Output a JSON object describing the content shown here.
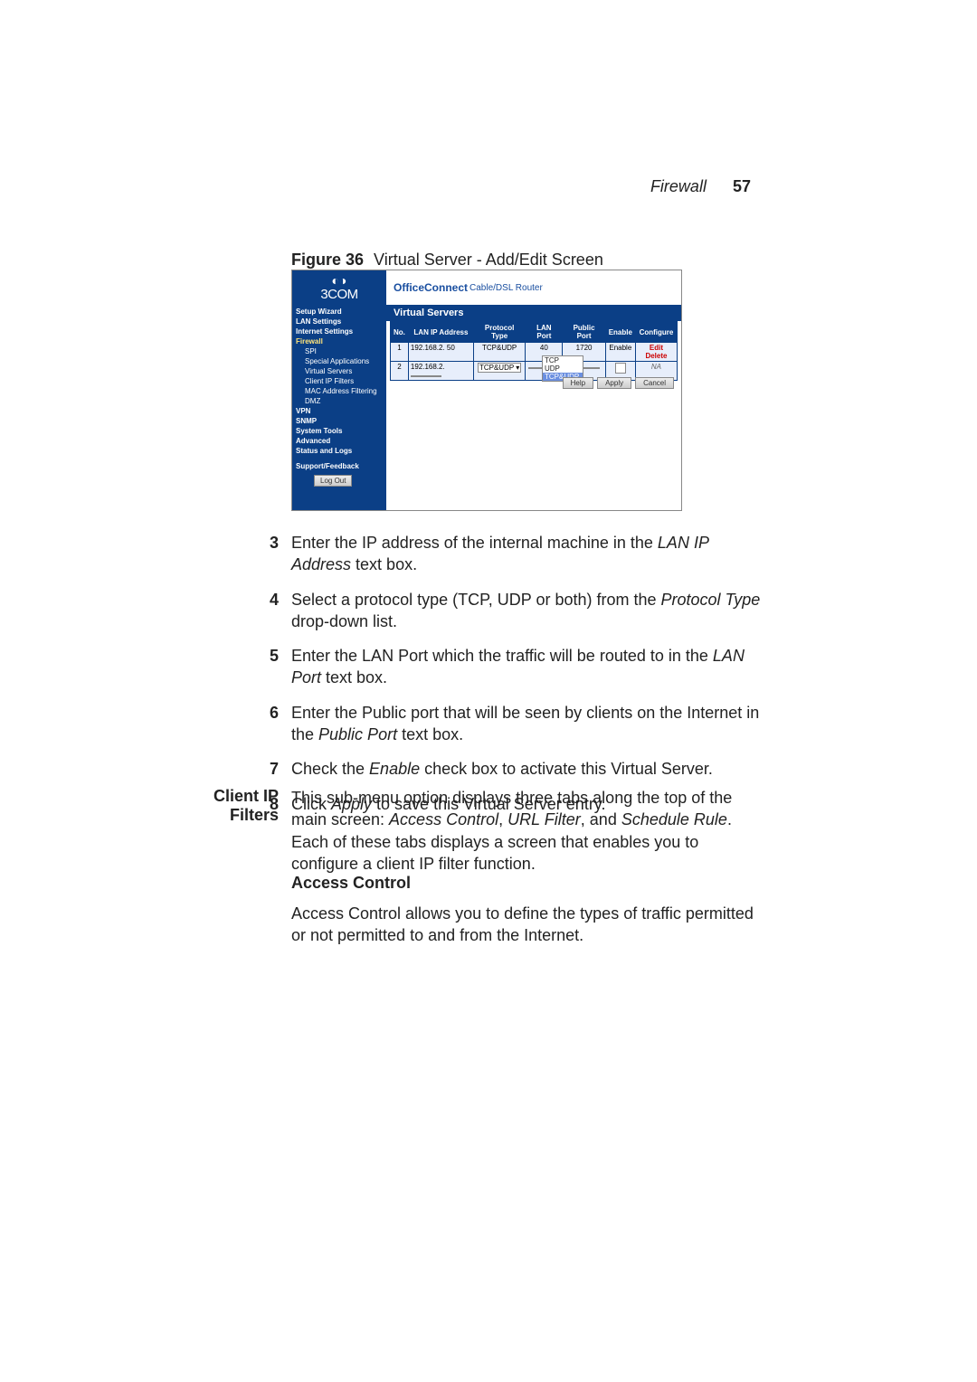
{
  "running_header": {
    "label": "Firewall",
    "page_num": "57"
  },
  "figure": {
    "label": "Figure 36",
    "caption": "Virtual Server - Add/Edit Screen"
  },
  "screenshot": {
    "brand_top": "3COM",
    "title_brand": "OfficeConnect",
    "title_sub": " Cable/DSL Router",
    "section": "Virtual Servers",
    "nav": {
      "items": [
        {
          "label": "Setup Wizard",
          "cls": "lvl0"
        },
        {
          "label": "LAN Settings",
          "cls": "lvl0"
        },
        {
          "label": "Internet Settings",
          "cls": "lvl0"
        },
        {
          "label": "Firewall",
          "cls": "lvl0 active"
        },
        {
          "label": "SPI",
          "cls": "lvl1"
        },
        {
          "label": "Special Applications",
          "cls": "lvl1"
        },
        {
          "label": "Virtual Servers",
          "cls": "lvl1"
        },
        {
          "label": "Client IP Filters",
          "cls": "lvl1"
        },
        {
          "label": "MAC Address Filtering",
          "cls": "lvl1"
        },
        {
          "label": "DMZ",
          "cls": "lvl1"
        },
        {
          "label": "VPN",
          "cls": "lvl0"
        },
        {
          "label": "SNMP",
          "cls": "lvl0"
        },
        {
          "label": "System Tools",
          "cls": "lvl0"
        },
        {
          "label": "Advanced",
          "cls": "lvl0"
        },
        {
          "label": "Status and Logs",
          "cls": "lvl0"
        },
        {
          "label": "",
          "cls": "sep"
        },
        {
          "label": "Support/Feedback",
          "cls": "lvl0"
        }
      ],
      "logout": "Log Out"
    },
    "table": {
      "headers": [
        "No.",
        "LAN IP Address",
        "Protocol Type",
        "LAN Port",
        "Public Port",
        "Enable",
        "Configure"
      ],
      "row1": {
        "no": "1",
        "ip": "192.168.2. 50",
        "proto": "TCP&UDP",
        "lan_port": "40",
        "pub_port": "1720",
        "enable": "Enable",
        "cfg_edit": "Edit",
        "cfg_del": "Delete"
      },
      "row2": {
        "no": "2",
        "ip_prefix": "192.168.2.",
        "proto_sel": "TCP&UDP ▾",
        "na": "NA",
        "dropdown": {
          "opt1": "TCP",
          "opt2": "UDP",
          "opt3": "TCP&UDP"
        }
      }
    },
    "buttons": {
      "help": "Help",
      "apply": "Apply",
      "cancel": "Cancel"
    }
  },
  "steps": [
    {
      "n": "3",
      "text_a": "Enter the IP address of the internal machine in the ",
      "em": "LAN IP Address",
      "text_b": " text box."
    },
    {
      "n": "4",
      "text_a": "Select a protocol type (TCP, UDP or both) from the ",
      "em": "Protocol Type",
      "text_b": " drop-down list."
    },
    {
      "n": "5",
      "text_a": "Enter the LAN Port which the traffic will be routed to in the ",
      "em": "LAN Port",
      "text_b": " text box."
    },
    {
      "n": "6",
      "text_a": "Enter the Public port that will be seen by clients on the Internet in the ",
      "em": "Public Port",
      "text_b": " text box."
    },
    {
      "n": "7",
      "text_a": "Check the ",
      "em": "Enable",
      "text_b": " check box to activate this Virtual Server."
    },
    {
      "n": "8",
      "text_a": "Click ",
      "em": "Apply",
      "text_b": " to save this Virtual Server entry."
    }
  ],
  "side_heading": "Client IP Filters",
  "para1": {
    "a": "This sub-menu option displays three tabs along the top of the main screen: ",
    "i1": "Access Control",
    "c1": ", ",
    "i2": "URL Filter",
    "c2": ", and ",
    "i3": "Schedule Rule",
    "b": ". Each of these tabs displays a screen that enables you to configure a client IP filter function."
  },
  "sub_heading": "Access Control",
  "para2": "Access Control allows you to define the types of traffic permitted or not permitted to and from the Internet."
}
